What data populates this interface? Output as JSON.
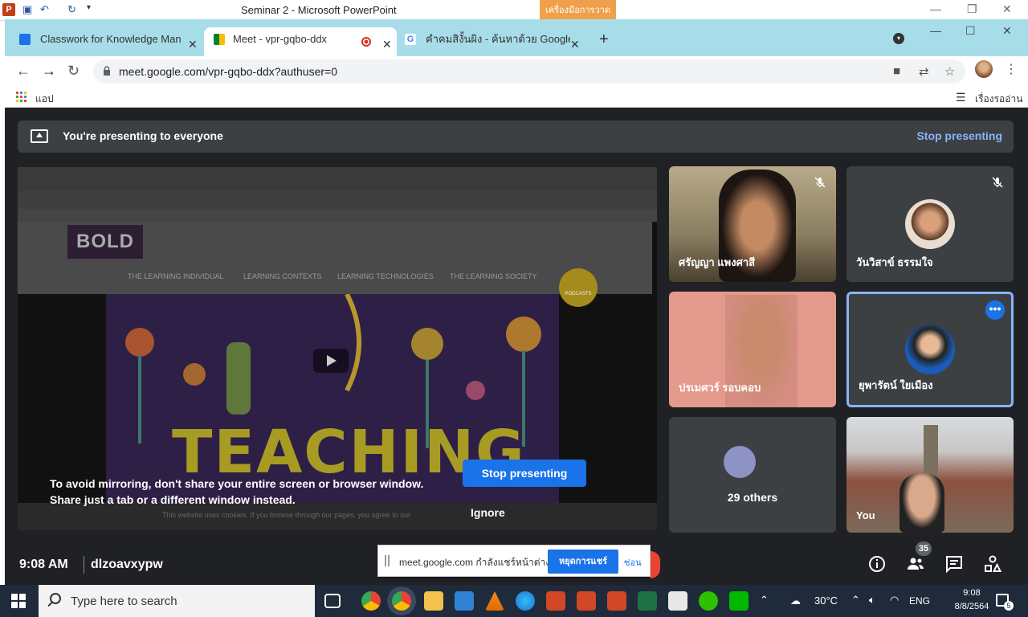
{
  "powerpoint": {
    "title": "Seminar 2  -  Microsoft PowerPoint",
    "tools_tab": "เครื่องมือการวาด"
  },
  "browser": {
    "tabs": [
      {
        "label": "Classwork for Knowledge Manag",
        "icon": "classroom-icon",
        "active": false
      },
      {
        "label": "Meet - vpr-gqbo-ddx",
        "icon": "meet-icon",
        "active": true
      },
      {
        "label": "คําคมสิงั้นผิง - ค้นหาด้วย Google",
        "icon": "google-icon",
        "active": false
      }
    ],
    "url": "meet.google.com/vpr-gqbo-ddx?authuser=0",
    "bookmarks": {
      "apps_label": "แอป",
      "reading_list_label": "เรื่องรออ่าน"
    }
  },
  "meet": {
    "banner_text": "You're presenting to everyone",
    "stop_presenting_link": "Stop presenting",
    "shared_screen": {
      "logo": "BOLD",
      "nav": [
        "THE LEARNING INDIVIDUAL",
        "LEARNING CONTEXTS",
        "LEARNING TECHNOLOGIES",
        "THE LEARNING SOCIETY"
      ],
      "podcast_label": "PODCASTS",
      "headline": "TEACHING",
      "cookie_text": "This website uses cookies. If you browse through our pages, you agree to our",
      "mirror_warning_line1": "To avoid mirroring, don't share your entire screen or browser window.",
      "mirror_warning_line2": "Share just a tab or a different window instead.",
      "stop_button": "Stop presenting",
      "ignore_button": "Ignore"
    },
    "participants": [
      {
        "name": "ศรัญญา แพงศาสี",
        "muted": true
      },
      {
        "name": "วันวิสาข์ ธรรมใจ",
        "muted": true
      },
      {
        "name": "ปรเมศวร์ รอบคอบ",
        "muted": false
      },
      {
        "name": "ยุพารัตน์ ใยเมือง",
        "muted": false
      }
    ],
    "others_label": "29 others",
    "you_label": "You",
    "time": "9:08 AM",
    "meeting_code": "dlzoavxypw",
    "people_count": "35",
    "sharing_notice": {
      "text": "meet.google.com กำลังแชร์หน้าต่าง",
      "stop_button": "หยุดการแชร์",
      "hide_button": "ซ่อน"
    }
  },
  "taskbar": {
    "search_placeholder": "Type here to search",
    "temperature": "30°C",
    "language": "ENG",
    "time": "9:08",
    "date": "8/8/2564",
    "notification_count": "5"
  },
  "colors": {
    "meet_bg": "#202124",
    "accent_blue": "#1a73e8",
    "link_blue": "#8ab4f8",
    "tabstrip": "#a7dde9"
  }
}
